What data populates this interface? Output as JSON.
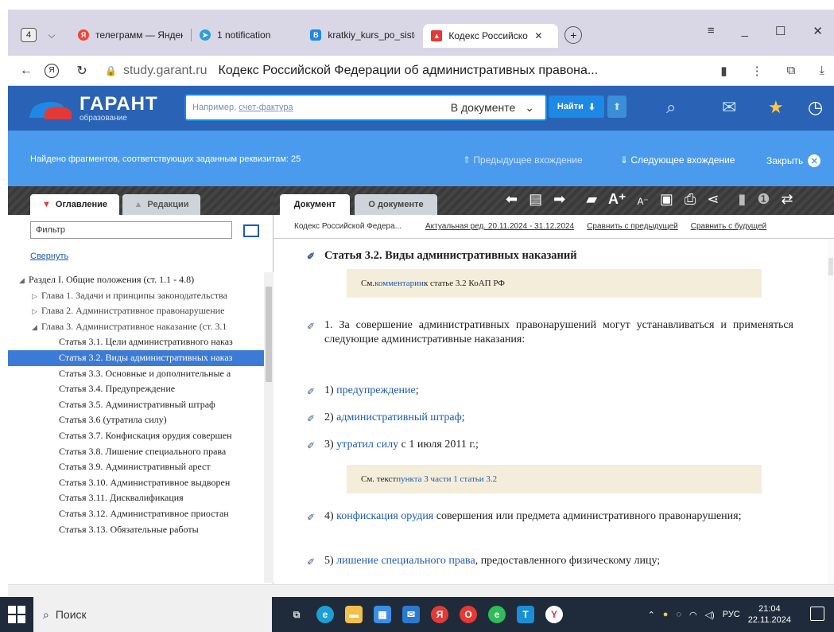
{
  "browser": {
    "tab_count": "4",
    "tabs": [
      {
        "label": "телеграмм — Яндекс",
        "fav_color": "#f44336",
        "fav_glyph": "Я"
      },
      {
        "label": "1 notification",
        "fav_color": "#2a9fd8",
        "fav_glyph": "➤"
      },
      {
        "label": "kratkiy_kurs_po_siste",
        "fav_color": "#1e88e5",
        "fav_glyph": "B"
      },
      {
        "label": "Кодекс Российской",
        "fav_color": "#e53935",
        "fav_glyph": "▲",
        "active": true
      }
    ],
    "host": "study.garant.ru",
    "page_title": "Кодекс Российской Федерации об административных правона..."
  },
  "garant": {
    "logo_big": "ГАРАНТ",
    "logo_small": "образование",
    "search_placeholder_prefix": "Например, ",
    "search_placeholder_link": "счет-фактура",
    "search_scope": "В документе",
    "find_label": "Найти"
  },
  "found_bar": {
    "text": "Найдено фрагментов, соответствующих заданным реквизитам: 25",
    "prev": "Предыдущее вхождение",
    "next": "Следующее вхождение",
    "close": "Закрыть"
  },
  "left_panel": {
    "tab_toc": "Оглавление",
    "tab_editions": "Редакции",
    "filter_placeholder": "Фильтр",
    "collapse": "Свернуть",
    "toc": [
      {
        "text": "Раздел I. Общие положения (ст. 1.1 - 4.8)",
        "level": 1,
        "arrow": "◢"
      },
      {
        "text": "Глава 1. Задачи и принципы законодательства",
        "level": 2,
        "arrow": "▷"
      },
      {
        "text": "Глава 2. Административное правонарушение",
        "level": 2,
        "arrow": "▷"
      },
      {
        "text": "Глава 3. Административное наказание (ст. 3.1",
        "level": 2,
        "arrow": "◢"
      },
      {
        "text": "Статья 3.1. Цели административного наказ",
        "level": 3
      },
      {
        "text": "Статья 3.2. Виды административных наказ",
        "level": 3,
        "selected": true
      },
      {
        "text": "Статья 3.3. Основные и дополнительные а",
        "level": 3
      },
      {
        "text": "Статья 3.4. Предупреждение",
        "level": 3
      },
      {
        "text": "Статья 3.5. Административный штраф",
        "level": 3
      },
      {
        "text": "Статья 3.6 (утратила силу)",
        "level": 3
      },
      {
        "text": "Статья 3.7. Конфискация орудия совершен",
        "level": 3
      },
      {
        "text": "Статья 3.8. Лишение специального права",
        "level": 3
      },
      {
        "text": "Статья 3.9. Административный арест",
        "level": 3
      },
      {
        "text": "Статья 3.10. Административное выдворен",
        "level": 3
      },
      {
        "text": "Статья 3.11. Дисквалификация",
        "level": 3
      },
      {
        "text": "Статья 3.12. Административное приостан",
        "level": 3
      },
      {
        "text": "Статья 3.13. Обязательные работы",
        "level": 3
      }
    ]
  },
  "doc_panel": {
    "tab_doc": "Документ",
    "tab_about": "О документе",
    "meta_title": "Кодекс Российской Федера...",
    "meta_edition": "Актуальная ред. 20.11.2024 - 31.12.2024",
    "meta_compare_prev": "Сравнить с предыдущей",
    "meta_compare_next": "Сравнить с будущей",
    "heading": "Статья 3.2. Виды административных наказаний",
    "note1_prefix": "См. ",
    "note1_link": "комментарии",
    "note1_suffix": " к статье 3.2 КоАП РФ",
    "p1": "1. За совершение административных правонарушений могут устанавливаться и применяться следующие административные наказания:",
    "i1_num": "1) ",
    "i1_link": "предупреждение",
    "i1_suffix": ";",
    "i2_num": "2) ",
    "i2_link": "административный штраф",
    "i2_suffix": ";",
    "i3_num": "3) ",
    "i3_link": "утратил силу",
    "i3_suffix": " с 1 июля 2011 г.;",
    "note2_prefix": "См. текст ",
    "note2_link": "пункта 3 части 1 статьи 3.2",
    "i4_num": "4) ",
    "i4_link": "конфискация орудия",
    "i4_suffix": " совершения или предмета административного правонарушения;",
    "i5_num": "5) ",
    "i5_link": "лишение специального права",
    "i5_suffix": ", предоставленного физическому лицу;"
  },
  "taskbar": {
    "search": "Поиск",
    "lang": "РУС",
    "time": "21:04",
    "date": "22.11.2024"
  }
}
